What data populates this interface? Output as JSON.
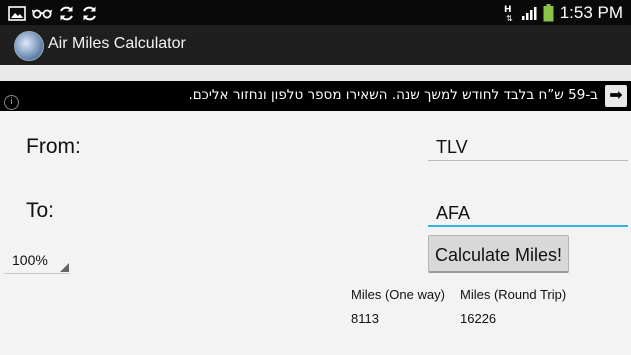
{
  "statusbar": {
    "time": "1:53 PM",
    "left_icons": [
      "image-icon",
      "glasses-icon",
      "sync-icon",
      "sync-icon"
    ],
    "right_icons": [
      "data-hplus-icon",
      "signal-icon",
      "battery-icon"
    ]
  },
  "app": {
    "title": "Air Miles Calculator",
    "icon": "globe-app-icon"
  },
  "ad": {
    "text": "ב-59 ש”ח בלבד לחודש למשך שנה. השאירו מספר טלפון ונחזור אליכם.",
    "info_icon": "info-icon",
    "arrow_icon": "arrow-right-icon"
  },
  "form": {
    "from_label": "From:",
    "from_value": "TLV",
    "to_label": "To:",
    "to_value": "AFA",
    "zoom_value": "100%",
    "calculate_label": "Calculate Miles!"
  },
  "results": {
    "one_way_label": "Miles (One way)",
    "one_way_value": "8113",
    "round_trip_label": "Miles (Round Trip)",
    "round_trip_value": "16226"
  },
  "colors": {
    "accent": "#33b5e5",
    "action_bar": "#1f1f1f",
    "battery": "#8bc34a"
  }
}
